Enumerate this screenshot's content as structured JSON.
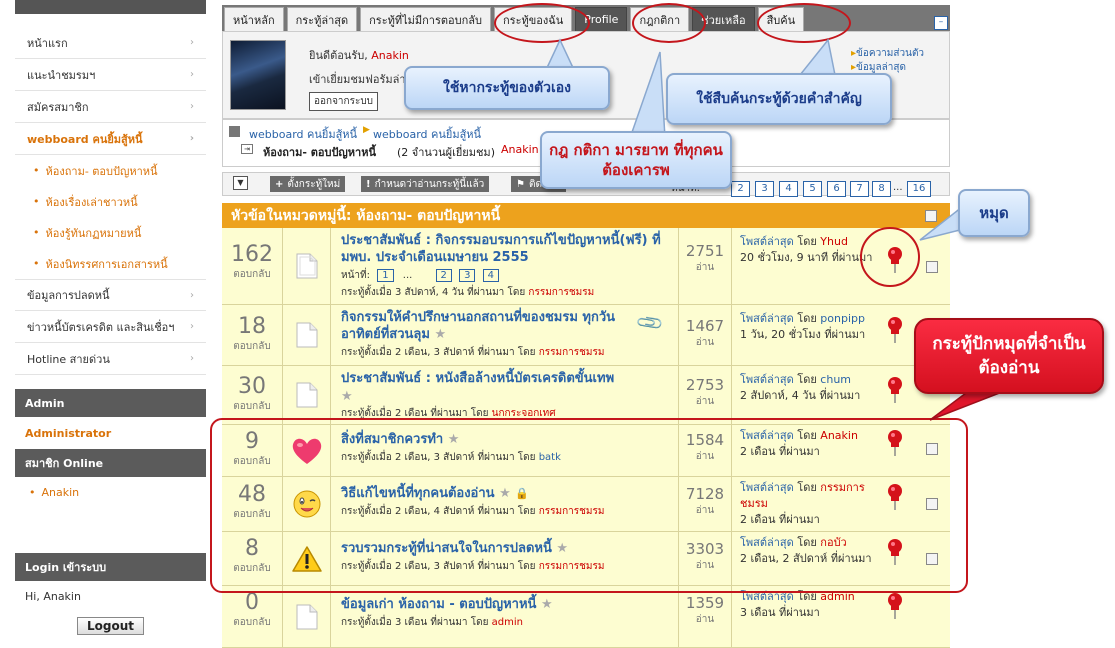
{
  "sidebar": {
    "nav": [
      {
        "label": "หน้าแรก"
      },
      {
        "label": "แนะนำชมรมฯ"
      },
      {
        "label": "สมัครสมาชิก"
      },
      {
        "label": "webboard คนยิ้มสู้หนี้"
      }
    ],
    "sub": [
      "ห้องถาม- ตอบปัญหาหนี้",
      "ห้องเรื่องเล่าชาวหนี้",
      "ห้องรู้ทันกฏหมายหนี้",
      "ห้องนิทรรศการเอกสารหนี้"
    ],
    "nav2": [
      "ข้อมูลการปลดหนี้",
      "ข่าวหนี้บัตรเครดิต และสินเชื่อฯ",
      "Hotline สายด่วน"
    ],
    "admin_head": "Admin",
    "admin_name": "Administrator",
    "online_head": "สมาชิก Online",
    "online_user": "Anakin",
    "login_head": "Login เข้าระบบ",
    "hi": "Hi, Anakin",
    "logout": "Logout"
  },
  "tabs": [
    "หน้าหลัก",
    "กระทู้ล่าสุด",
    "กระทู้ที่ไม่มีการตอบกลับ",
    "กระทู้ของฉัน",
    "Profile",
    "กฎกติกา",
    "ช่วยเหลือ",
    "สืบค้น"
  ],
  "welcome": {
    "greeting": "ยินดีต้อนรับ,",
    "user": "Anakin",
    "last_visit": "เข้าเยี่ยมชมฟอรัมล่าสุด: วันนี้",
    "logout_btn": "ออกจากระบบ",
    "private_msg": "ข้อความส่วนตัว",
    "notify": "ข้อมูลล่าสุด"
  },
  "breadcrumb": {
    "item1": "webboard คนยิ้มสู้หนี้",
    "item2": "webboard คนยิ้มสู้หนี้",
    "room": "ห้องถาม- ตอบปัญหาหนี้",
    "viewers": "(2 จำนวนผู้เยี่ยมชม)",
    "viewer_name": "Anakin"
  },
  "toolbar": {
    "new_topic": "ตั้งกระทู้ใหม่",
    "mark_read": "กำหนดว่าอ่านกระทู้นี้แล้ว",
    "follow": "ติดตาม",
    "page_label": "หน้าที่:",
    "pages": [
      "2",
      "3",
      "4",
      "5",
      "6",
      "7",
      "8",
      "...",
      "16"
    ]
  },
  "forum_title": "หัวข้อในหมวดหมู่นี้: ห้องถาม- ตอบปัญหาหนี้",
  "topics": [
    {
      "replies": "162",
      "reply_lbl": "ตอบกลับ",
      "title": "ประชาสัมพันธ์ : กิจกรรมอบรมการแก้ไขปัญหาหนี้(ฟรี) ที่ มพบ. ประจำเดือนเมษายน 2555",
      "pages_lbl": "หน้าที่:",
      "pages": [
        "1",
        "...",
        "2",
        "3",
        "4"
      ],
      "meta": "กระทู้ตั้งเมื่อ 3 สัปดาห์, 4 วัน ที่ผ่านมา โดย",
      "by": "กรรมการชมรม",
      "views": "2751",
      "views_lbl": "อ่าน",
      "last_lbl": "โพสต์ล่าสุด",
      "last_by_word": "โดย",
      "last_by": "Yhud",
      "last_time": "20 ชั่วโมง, 9 นาที ที่ผ่านมา"
    },
    {
      "replies": "18",
      "reply_lbl": "ตอบกลับ",
      "title": "กิจกรรมให้คำปรึกษานอกสถานที่ของชมรม ทุกวันอาทิตย์ที่สวนลุม",
      "meta": "กระทู้ตั้งเมื่อ 2 เดือน, 3 สัปดาห์ ที่ผ่านมา โดย",
      "by": "กรรมการชมรม",
      "views": "1467",
      "views_lbl": "อ่าน",
      "last_lbl": "โพสต์ล่าสุด",
      "last_by_word": "โดย",
      "last_by": "ponpipp",
      "last_time": "1 วัน, 20 ชั่วโมง ที่ผ่านมา"
    },
    {
      "replies": "30",
      "reply_lbl": "ตอบกลับ",
      "title": "ประชาสัมพันธ์ : หนังสือล้างหนี้บัตรเครดิตขั้นเทพ",
      "meta": "กระทู้ตั้งเมื่อ 2 เดือน ที่ผ่านมา โดย",
      "by": "นกกระจอกเทศ",
      "views": "2753",
      "views_lbl": "อ่าน",
      "last_lbl": "โพสต์ล่าสุด",
      "last_by_word": "โดย",
      "last_by": "chum",
      "last_time": "2 สัปดาห์, 4 วัน ที่ผ่านมา"
    },
    {
      "replies": "9",
      "reply_lbl": "ตอบกลับ",
      "title": "สิ่งที่สมาชิกควรทำ",
      "meta": "กระทู้ตั้งเมื่อ 2 เดือน, 3 สัปดาห์ ที่ผ่านมา โดย",
      "by": "batk",
      "views": "1584",
      "views_lbl": "อ่าน",
      "last_lbl": "โพสต์ล่าสุด",
      "last_by_word": "โดย",
      "last_by": "Anakin",
      "last_time": "2 เดือน ที่ผ่านมา"
    },
    {
      "replies": "48",
      "reply_lbl": "ตอบกลับ",
      "title": "วิธีแก้ไขหนี้ที่ทุกคนต้องอ่าน",
      "meta": "กระทู้ตั้งเมื่อ 2 เดือน, 4 สัปดาห์ ที่ผ่านมา โดย",
      "by": "กรรมการชมรม",
      "views": "7128",
      "views_lbl": "อ่าน",
      "last_lbl": "โพสต์ล่าสุด",
      "last_by_word": "โดย",
      "last_by": "กรรมการชมรม",
      "last_time": "2 เดือน ที่ผ่านมา"
    },
    {
      "replies": "8",
      "reply_lbl": "ตอบกลับ",
      "title": "รวบรวมกระทู้ที่น่าสนใจในการปลดหนี้",
      "meta": "กระทู้ตั้งเมื่อ 2 เดือน, 3 สัปดาห์ ที่ผ่านมา โดย",
      "by": "กรรมการชมรม",
      "views": "3303",
      "views_lbl": "อ่าน",
      "last_lbl": "โพสต์ล่าสุด",
      "last_by_word": "โดย",
      "last_by": "กอบัว",
      "last_time": "2 เดือน, 2 สัปดาห์ ที่ผ่านมา"
    },
    {
      "replies": "0",
      "reply_lbl": "ตอบกลับ",
      "title": "ข้อมูลเก่า ห้องถาม - ตอบปัญหาหนี้",
      "meta": "กระทู้ตั้งเมื่อ 3 เดือน ที่ผ่านมา โดย",
      "by": "admin",
      "views": "1359",
      "views_lbl": "อ่าน",
      "last_lbl": "โพสต์ล่าสุด",
      "last_by_word": "โดย",
      "last_by": "admin",
      "last_time": "3 เดือน ที่ผ่านมา"
    }
  ],
  "callouts": {
    "my_topics": "ใช้หากระทู้ของตัวเอง",
    "search": "ใช้สืบค้นกระทู้ด้วยคำสำคัญ",
    "rules": "กฎ กติกา มารยาท ที่ทุกคนต้องเคารพ",
    "pin": "หมุด",
    "pinned": "กระทู้ปักหมุดที่จำเป็นต้องอ่าน"
  },
  "colors": {
    "accent": "#eda21d",
    "link": "#2a63a8",
    "row_bg": "#fdfdd1",
    "annotation": "#c4161c"
  }
}
